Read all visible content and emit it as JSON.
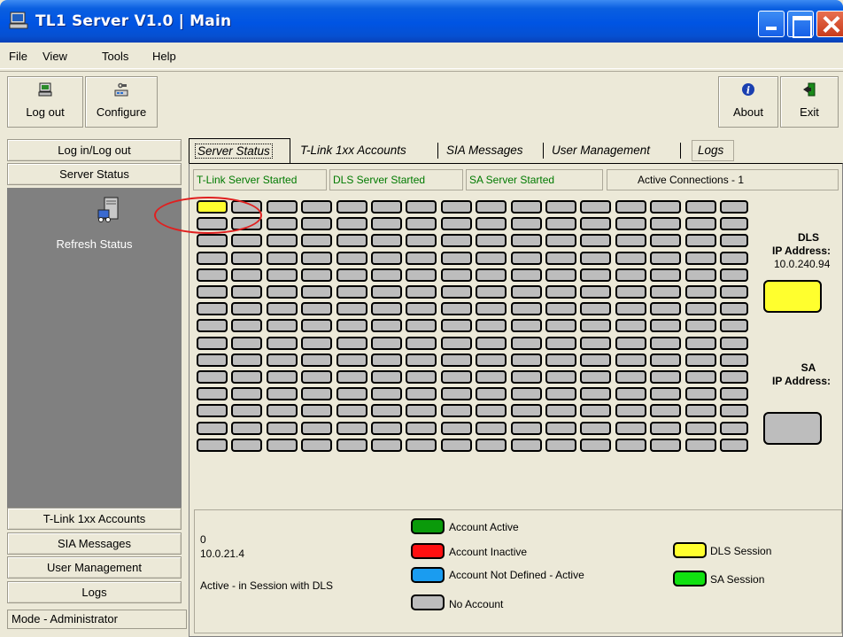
{
  "window": {
    "title": "TL1 Server V1.0 | Main"
  },
  "menu": {
    "items": [
      "File",
      "View",
      "Tools",
      "Help"
    ]
  },
  "toolbar": {
    "logout_label": "Log out",
    "configure_label": "Configure",
    "about_label": "About",
    "exit_label": "Exit"
  },
  "sidebar": {
    "top_buttons": [
      "Log in/Log out",
      "Server Status"
    ],
    "refresh_label": "Refresh Status",
    "bottom_buttons": [
      "T-Link 1xx Accounts",
      "SIA Messages",
      "User Management",
      "Logs"
    ],
    "mode": "Mode - Administrator"
  },
  "tabs": [
    "Server Status",
    "T-Link 1xx Accounts",
    "SIA Messages",
    "User Management",
    "Logs"
  ],
  "status": {
    "tlink": "T-Link Server Started",
    "dls": "DLS Server Started",
    "sa": "SA Server Started",
    "connections": "Active Connections - 1"
  },
  "grid": {
    "rows": 15,
    "cols": 16,
    "dls_session_cells": [
      0
    ]
  },
  "dls_panel": {
    "label": "DLS",
    "ip_label": "IP Address:",
    "ip": "10.0.240.94",
    "color": "#FFFF2E"
  },
  "sa_panel": {
    "label": "SA",
    "ip_label": "IP Address:",
    "ip": "",
    "color": "#BDBDBD"
  },
  "details": {
    "account": "0",
    "ip": "10.0.21.4",
    "state": "Active - in Session with DLS"
  },
  "legend": {
    "account_active": {
      "label": "Account Active",
      "color": "#0A9A0A"
    },
    "account_inactive": {
      "label": "Account Inactive",
      "color": "#FF1010"
    },
    "not_defined_active": {
      "label": "Account Not Defined - Active",
      "color": "#1A9CF0"
    },
    "no_account": {
      "label": "No Account",
      "color": "#BDBDBD"
    },
    "dls_session": {
      "label": "DLS Session",
      "color": "#FFFF2E"
    },
    "sa_session": {
      "label": "SA Session",
      "color": "#10E010"
    }
  }
}
